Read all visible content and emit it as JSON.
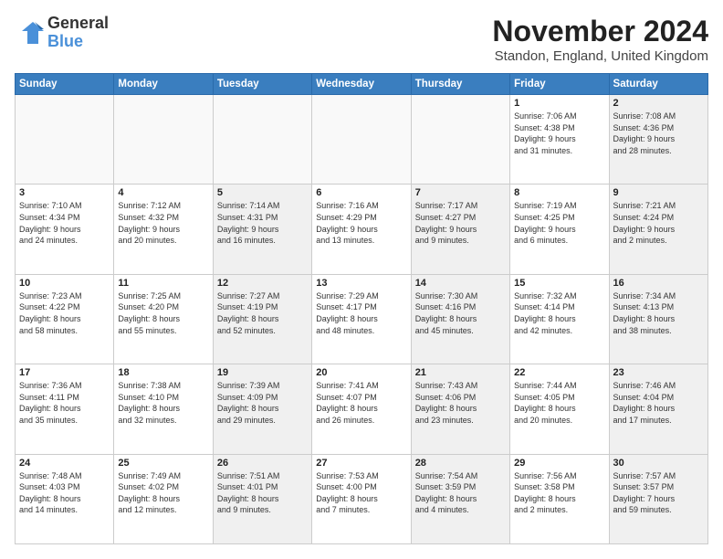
{
  "header": {
    "logo_line1": "General",
    "logo_line2": "Blue",
    "month": "November 2024",
    "location": "Standon, England, United Kingdom"
  },
  "weekdays": [
    "Sunday",
    "Monday",
    "Tuesday",
    "Wednesday",
    "Thursday",
    "Friday",
    "Saturday"
  ],
  "weeks": [
    [
      {
        "day": "",
        "info": ""
      },
      {
        "day": "",
        "info": ""
      },
      {
        "day": "",
        "info": ""
      },
      {
        "day": "",
        "info": ""
      },
      {
        "day": "",
        "info": ""
      },
      {
        "day": "1",
        "info": "Sunrise: 7:06 AM\nSunset: 4:38 PM\nDaylight: 9 hours\nand 31 minutes."
      },
      {
        "day": "2",
        "info": "Sunrise: 7:08 AM\nSunset: 4:36 PM\nDaylight: 9 hours\nand 28 minutes."
      }
    ],
    [
      {
        "day": "3",
        "info": "Sunrise: 7:10 AM\nSunset: 4:34 PM\nDaylight: 9 hours\nand 24 minutes."
      },
      {
        "day": "4",
        "info": "Sunrise: 7:12 AM\nSunset: 4:32 PM\nDaylight: 9 hours\nand 20 minutes."
      },
      {
        "day": "5",
        "info": "Sunrise: 7:14 AM\nSunset: 4:31 PM\nDaylight: 9 hours\nand 16 minutes."
      },
      {
        "day": "6",
        "info": "Sunrise: 7:16 AM\nSunset: 4:29 PM\nDaylight: 9 hours\nand 13 minutes."
      },
      {
        "day": "7",
        "info": "Sunrise: 7:17 AM\nSunset: 4:27 PM\nDaylight: 9 hours\nand 9 minutes."
      },
      {
        "day": "8",
        "info": "Sunrise: 7:19 AM\nSunset: 4:25 PM\nDaylight: 9 hours\nand 6 minutes."
      },
      {
        "day": "9",
        "info": "Sunrise: 7:21 AM\nSunset: 4:24 PM\nDaylight: 9 hours\nand 2 minutes."
      }
    ],
    [
      {
        "day": "10",
        "info": "Sunrise: 7:23 AM\nSunset: 4:22 PM\nDaylight: 8 hours\nand 58 minutes."
      },
      {
        "day": "11",
        "info": "Sunrise: 7:25 AM\nSunset: 4:20 PM\nDaylight: 8 hours\nand 55 minutes."
      },
      {
        "day": "12",
        "info": "Sunrise: 7:27 AM\nSunset: 4:19 PM\nDaylight: 8 hours\nand 52 minutes."
      },
      {
        "day": "13",
        "info": "Sunrise: 7:29 AM\nSunset: 4:17 PM\nDaylight: 8 hours\nand 48 minutes."
      },
      {
        "day": "14",
        "info": "Sunrise: 7:30 AM\nSunset: 4:16 PM\nDaylight: 8 hours\nand 45 minutes."
      },
      {
        "day": "15",
        "info": "Sunrise: 7:32 AM\nSunset: 4:14 PM\nDaylight: 8 hours\nand 42 minutes."
      },
      {
        "day": "16",
        "info": "Sunrise: 7:34 AM\nSunset: 4:13 PM\nDaylight: 8 hours\nand 38 minutes."
      }
    ],
    [
      {
        "day": "17",
        "info": "Sunrise: 7:36 AM\nSunset: 4:11 PM\nDaylight: 8 hours\nand 35 minutes."
      },
      {
        "day": "18",
        "info": "Sunrise: 7:38 AM\nSunset: 4:10 PM\nDaylight: 8 hours\nand 32 minutes."
      },
      {
        "day": "19",
        "info": "Sunrise: 7:39 AM\nSunset: 4:09 PM\nDaylight: 8 hours\nand 29 minutes."
      },
      {
        "day": "20",
        "info": "Sunrise: 7:41 AM\nSunset: 4:07 PM\nDaylight: 8 hours\nand 26 minutes."
      },
      {
        "day": "21",
        "info": "Sunrise: 7:43 AM\nSunset: 4:06 PM\nDaylight: 8 hours\nand 23 minutes."
      },
      {
        "day": "22",
        "info": "Sunrise: 7:44 AM\nSunset: 4:05 PM\nDaylight: 8 hours\nand 20 minutes."
      },
      {
        "day": "23",
        "info": "Sunrise: 7:46 AM\nSunset: 4:04 PM\nDaylight: 8 hours\nand 17 minutes."
      }
    ],
    [
      {
        "day": "24",
        "info": "Sunrise: 7:48 AM\nSunset: 4:03 PM\nDaylight: 8 hours\nand 14 minutes."
      },
      {
        "day": "25",
        "info": "Sunrise: 7:49 AM\nSunset: 4:02 PM\nDaylight: 8 hours\nand 12 minutes."
      },
      {
        "day": "26",
        "info": "Sunrise: 7:51 AM\nSunset: 4:01 PM\nDaylight: 8 hours\nand 9 minutes."
      },
      {
        "day": "27",
        "info": "Sunrise: 7:53 AM\nSunset: 4:00 PM\nDaylight: 8 hours\nand 7 minutes."
      },
      {
        "day": "28",
        "info": "Sunrise: 7:54 AM\nSunset: 3:59 PM\nDaylight: 8 hours\nand 4 minutes."
      },
      {
        "day": "29",
        "info": "Sunrise: 7:56 AM\nSunset: 3:58 PM\nDaylight: 8 hours\nand 2 minutes."
      },
      {
        "day": "30",
        "info": "Sunrise: 7:57 AM\nSunset: 3:57 PM\nDaylight: 7 hours\nand 59 minutes."
      }
    ]
  ]
}
